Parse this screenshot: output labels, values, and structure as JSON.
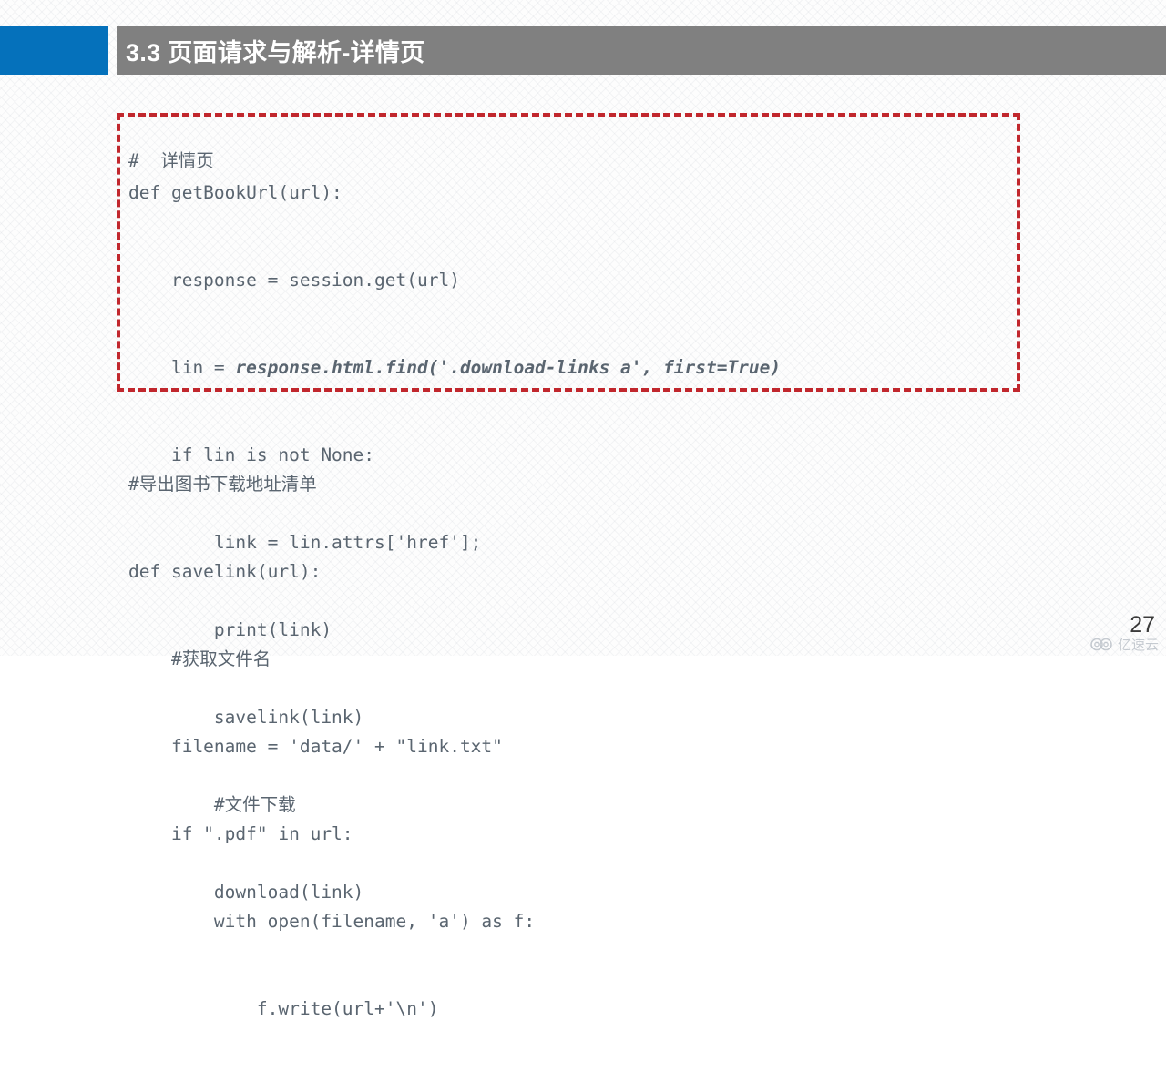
{
  "header": {
    "title": "3.3 页面请求与解析-详情页",
    "accent_color": "#0571bb",
    "bar_color": "#808080",
    "title_color": "#ffffff"
  },
  "content": {
    "comment_line": "#  详情页",
    "highlight_box": {
      "border_color": "#c1272d",
      "border_style": "dashed"
    },
    "code_top": [
      {
        "text": "def getBookUrl(url):"
      },
      {
        "text": "    response = session.get(url)"
      },
      {
        "prefix": "    lin = ",
        "emphasis": "response.html.find('.download-links a', first=True)"
      },
      {
        "text": "    if lin is not None:"
      },
      {
        "text": "        link = lin.attrs['href'];"
      },
      {
        "text": "        print(link)"
      },
      {
        "text": "        savelink(link)"
      },
      {
        "text": "        #文件下载"
      },
      {
        "text": "        download(link)"
      }
    ],
    "code_bottom": [
      {
        "text": "#导出图书下载地址清单"
      },
      {
        "text": "def savelink(url):"
      },
      {
        "text": "    #获取文件名"
      },
      {
        "text": "    filename = 'data/' + \"link.txt\""
      },
      {
        "text": "    if \".pdf\" in url:"
      },
      {
        "text": "        with open(filename, 'a') as f:"
      },
      {
        "text": "            f.write(url+'\\n')"
      }
    ],
    "code_color": "#5a6570"
  },
  "footer": {
    "page_number": "27",
    "watermark_text": "亿速云",
    "watermark_icon": "cloud-logo-icon"
  }
}
